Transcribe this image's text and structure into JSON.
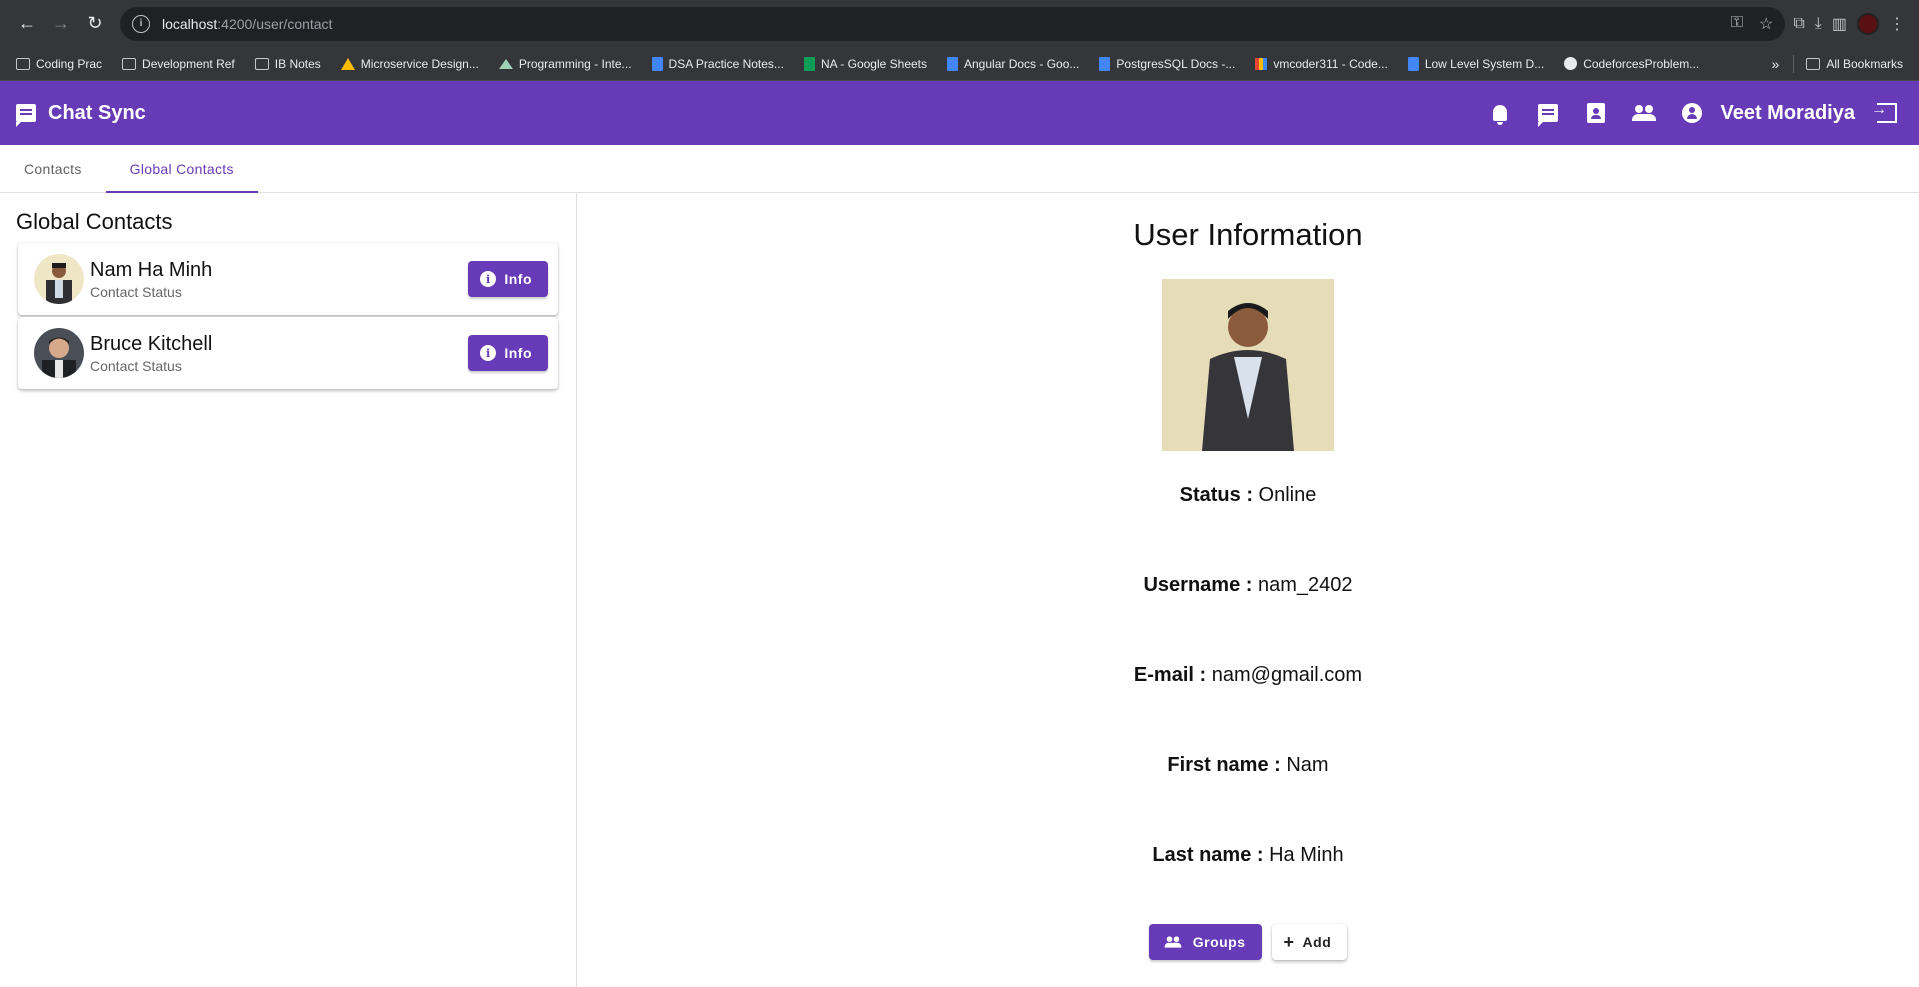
{
  "browser": {
    "url_host": "localhost",
    "url_rest": ":4200/user/contact",
    "bookmarks": [
      {
        "label": "Coding Prac",
        "icon": "folder"
      },
      {
        "label": "Development Ref",
        "icon": "folder"
      },
      {
        "label": "IB Notes",
        "icon": "folder"
      },
      {
        "label": "Microservice Design...",
        "icon": "drive"
      },
      {
        "label": "Programming - Inte...",
        "icon": "mtn"
      },
      {
        "label": "DSA Practice Notes...",
        "icon": "doc"
      },
      {
        "label": "NA - Google Sheets",
        "icon": "sheet"
      },
      {
        "label": "Angular Docs - Goo...",
        "icon": "doc"
      },
      {
        "label": "PostgresSQL Docs -...",
        "icon": "doc"
      },
      {
        "label": "vmcoder311 - Code...",
        "icon": "bar"
      },
      {
        "label": "Low Level System D...",
        "icon": "doc"
      },
      {
        "label": "CodeforcesProblem...",
        "icon": "globe"
      }
    ],
    "all_bookmarks": "All Bookmarks"
  },
  "app": {
    "title": "Chat Sync",
    "user_name": "Veet Moradiya",
    "brand_color": "#673ab7"
  },
  "tabs": [
    {
      "label": "Contacts",
      "active": false
    },
    {
      "label": "Global Contacts",
      "active": true
    }
  ],
  "contacts": {
    "heading": "Global Contacts",
    "items": [
      {
        "name": "Nam Ha Minh",
        "status": "Contact Status",
        "button": "Info"
      },
      {
        "name": "Bruce Kitchell",
        "status": "Contact Status",
        "button": "Info"
      }
    ]
  },
  "details": {
    "heading": "User Information",
    "fields": [
      {
        "label": "Status :",
        "value": "Online"
      },
      {
        "label": "Username :",
        "value": "nam_2402"
      },
      {
        "label": "E-mail :",
        "value": "nam@gmail.com"
      },
      {
        "label": "First name :",
        "value": "Nam"
      },
      {
        "label": "Last name :",
        "value": "Ha Minh"
      }
    ],
    "groups_button": "Groups",
    "add_button": "Add"
  }
}
